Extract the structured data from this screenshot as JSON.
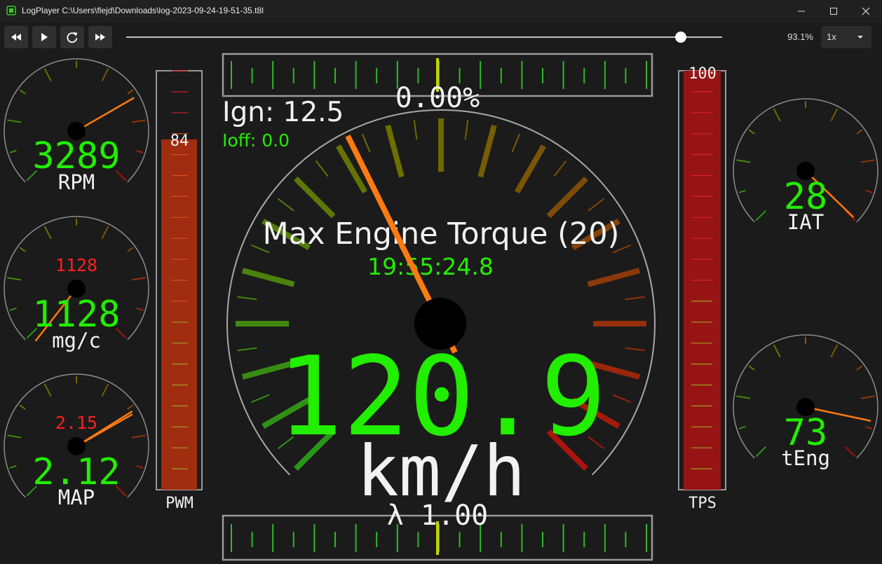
{
  "window": {
    "title": "LogPlayer C:\\Users\\flejd\\Downloads\\log-2023-09-24-19-51-35.t8l"
  },
  "toolbar": {
    "rewind_icon": "fast-rewind-icon",
    "play_icon": "play-icon",
    "restart_icon": "restart-icon",
    "forward_icon": "fast-forward-icon",
    "progress": 0.931,
    "progress_text": "93.1%",
    "speed_value": "1x"
  },
  "colors": {
    "background": "#1b1b1b",
    "needle": "#ff7a10",
    "value_green": "#22ee00",
    "warn_red": "#ff1f1f",
    "bar_fill": "#a02d10",
    "tps_fill": "#961414"
  },
  "gauges": {
    "rpm": {
      "value": "3289",
      "label": "RPM"
    },
    "mgc": {
      "value": "1128",
      "label": "mg/c",
      "peak": "1128"
    },
    "map": {
      "value": "2.12",
      "label": "MAP",
      "peak": "2.15"
    },
    "iat": {
      "value": "28",
      "label": "IAT"
    },
    "teng": {
      "value": "73",
      "label": "tEng"
    }
  },
  "bars": {
    "pwm": {
      "label": "PWM",
      "value_text": "84",
      "level": 0.84
    },
    "tps": {
      "label": "TPS",
      "value_text": "100",
      "level": 1.0
    }
  },
  "center": {
    "ign": "Ign: 12.5",
    "ioff": "Ioff: 0.0",
    "top_scale_value": "0.00%",
    "event": "Max Engine Torque (20)",
    "time": "19:55:24.8",
    "speed": "120.9",
    "unit": "km/h",
    "lambda": "λ 1.00"
  }
}
